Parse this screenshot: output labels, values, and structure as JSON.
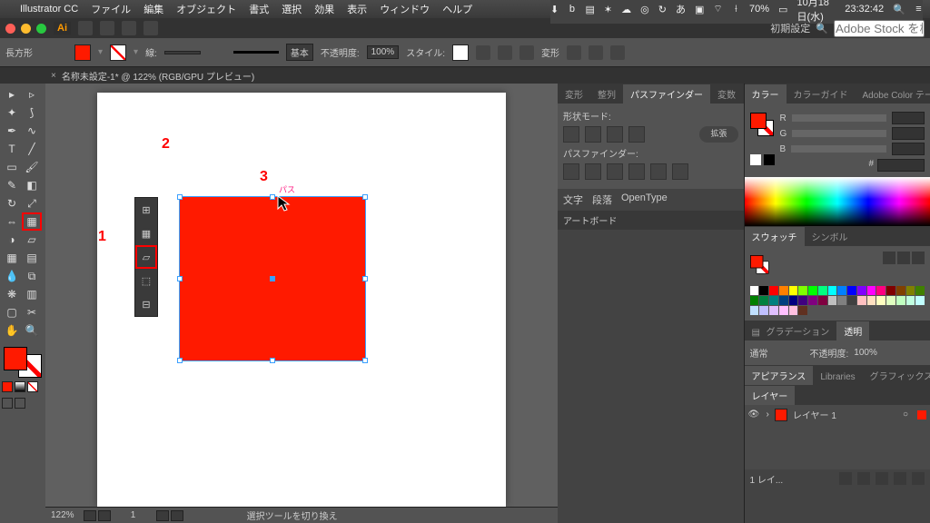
{
  "macbar": {
    "app": "Illustrator CC",
    "menus": [
      "ファイル",
      "編集",
      "オブジェクト",
      "書式",
      "選択",
      "効果",
      "表示",
      "ウィンドウ",
      "ヘルプ"
    ],
    "battery": "70%",
    "date": "10月18日(水)",
    "time": "23:32:42"
  },
  "app_header": {
    "brand": "Ai",
    "workspace": "初期設定",
    "search_placeholder": "Adobe Stock を検索"
  },
  "ctrl": {
    "shape": "長方形",
    "stroke_label": "線:",
    "stroke_pt": "",
    "stroke_style": "基本",
    "opacity_label": "不透明度:",
    "opacity": "100%",
    "style_label": "スタイル:",
    "transform_label": "変形"
  },
  "doc_tab": {
    "title": "名称未設定-1* @ 122% (RGB/GPU プレビュー)",
    "zoom": "122%",
    "page": "1"
  },
  "annotations": {
    "one": "1",
    "two": "2",
    "three": "3",
    "path": "パス"
  },
  "status": {
    "hint": "選択ツールを切り換え"
  },
  "panels": {
    "left_tabs": [
      "変形",
      "整列",
      "パスファインダー",
      "変数"
    ],
    "pf_shape_label": "形状モード:",
    "pf_pathfinder_label": "パスファインダー:",
    "pf_expand": "拡張",
    "text_tabs": [
      "文字",
      "段落",
      "OpenType"
    ],
    "artboard": "アートボード",
    "color_tabs": [
      "カラー",
      "カラーガイド",
      "Adobe Color テーマ"
    ],
    "rgb": {
      "r": "R",
      "g": "G",
      "b": "B"
    },
    "swatch_tabs": [
      "スウォッチ",
      "シンボル"
    ],
    "grad_tabs_a": "グラデーション",
    "grad_tabs_b": "透明",
    "blend": "通常",
    "blend_opacity_label": "不透明度:",
    "blend_opacity": "100%",
    "appear_tabs": [
      "アピアランス",
      "Libraries",
      "グラフィックスタイル"
    ],
    "layer_tab": "レイヤー",
    "layer_name": "レイヤー 1",
    "layer_count": "1 レイ..."
  },
  "sw_colors": [
    "#fff",
    "#000",
    "#f00",
    "#ff8000",
    "#ff0",
    "#80ff00",
    "#0f0",
    "#00ff80",
    "#0ff",
    "#0080ff",
    "#00f",
    "#8000ff",
    "#f0f",
    "#ff0080",
    "#800000",
    "#804000",
    "#808000",
    "#408000",
    "#008000",
    "#008040",
    "#008080",
    "#004080",
    "#000080",
    "#400080",
    "#800080",
    "#800040",
    "#c0c0c0",
    "#808080",
    "#404040",
    "#ffc0c0",
    "#ffe0c0",
    "#ffffc0",
    "#e0ffc0",
    "#c0ffc0",
    "#c0ffe0",
    "#c0ffff",
    "#c0e0ff",
    "#c0c0ff",
    "#e0c0ff",
    "#ffc0ff",
    "#ffc0e0",
    "#603020"
  ]
}
